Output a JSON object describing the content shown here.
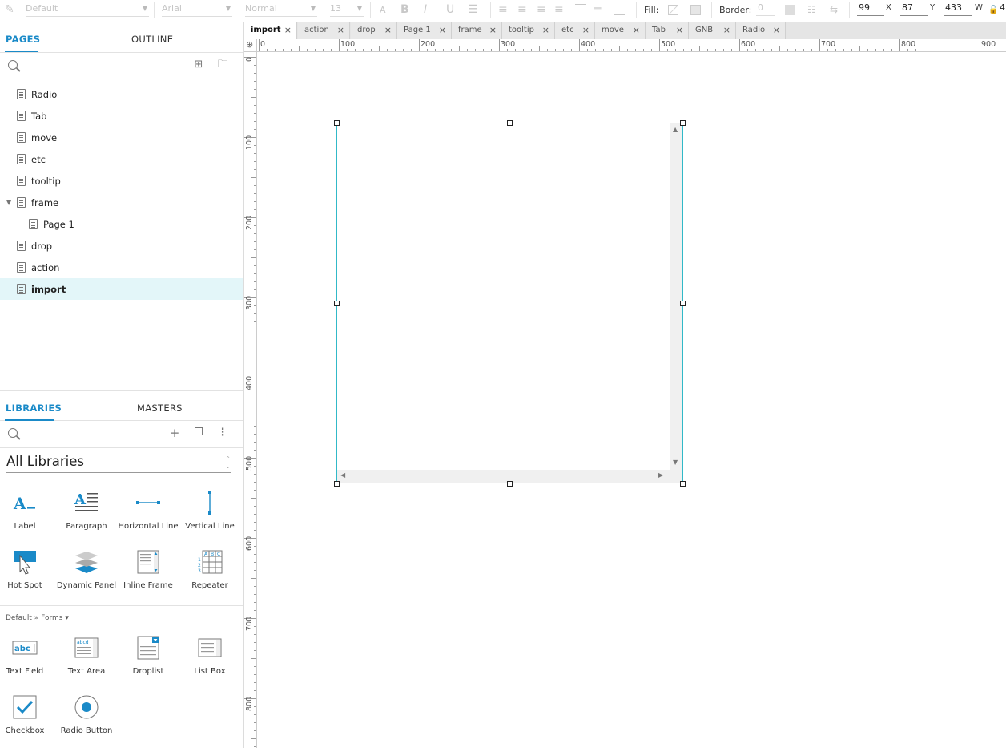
{
  "toolbar": {
    "style_select": "Default",
    "font_select": "Arial",
    "weight_select": "Normal",
    "size_select": "13",
    "fill_label": "Fill:",
    "border_label": "Border:",
    "border_value": "0",
    "x_value": "99",
    "x_label": "X",
    "y_value": "87",
    "y_label": "Y",
    "w_value": "433",
    "w_label": "W",
    "overflow_value": "4"
  },
  "pages_panel": {
    "tabs": [
      "PAGES",
      "OUTLINE"
    ],
    "pages": [
      {
        "label": "Radio"
      },
      {
        "label": "Tab"
      },
      {
        "label": "move"
      },
      {
        "label": "etc"
      },
      {
        "label": "tooltip"
      },
      {
        "label": "frame"
      },
      {
        "label": "Page 1"
      },
      {
        "label": "drop"
      },
      {
        "label": "action"
      },
      {
        "label": "import"
      }
    ]
  },
  "libraries_panel": {
    "tabs": [
      "LIBRARIES",
      "MASTERS"
    ],
    "library_select": "All Libraries",
    "widgets_common": [
      "Label",
      "Paragraph",
      "Horizontal Line",
      "Vertical Line",
      "Hot Spot",
      "Dynamic Panel",
      "Inline Frame",
      "Repeater"
    ],
    "breadcrumb": "Default » Forms ▾",
    "widgets_forms": [
      "Text Field",
      "Text Area",
      "Droplist",
      "List Box",
      "Checkbox",
      "Radio Button"
    ],
    "text_field_icon_text": "abc",
    "text_area_icon_text": "abcd",
    "repeater_icon_text": [
      "A",
      "B",
      "C",
      "1",
      "2",
      "3"
    ]
  },
  "doc_tabs": [
    "import",
    "action",
    "drop",
    "Page 1",
    "frame",
    "tooltip",
    "etc",
    "move",
    "Tab",
    "GNB",
    "Radio"
  ],
  "rulers": {
    "h_labels": [
      "0",
      "100",
      "200",
      "300",
      "400",
      "500",
      "600",
      "700",
      "800",
      "900"
    ],
    "v_labels": [
      "0",
      "100",
      "200",
      "300",
      "400",
      "500",
      "600",
      "700",
      "800"
    ]
  },
  "colors": {
    "accent": "#1a8ac8",
    "selection": "#31b9c8",
    "selected_row": "#e3f6f9"
  },
  "icons": {
    "pages_search": "search-icon",
    "add_page": "add-page-icon",
    "add_folder": "folder-icon",
    "libraries_search": "search-icon",
    "add_library": "plus-icon",
    "library_duplicate": "duplicate-icon",
    "library_menu": "more-vertical-icon"
  }
}
